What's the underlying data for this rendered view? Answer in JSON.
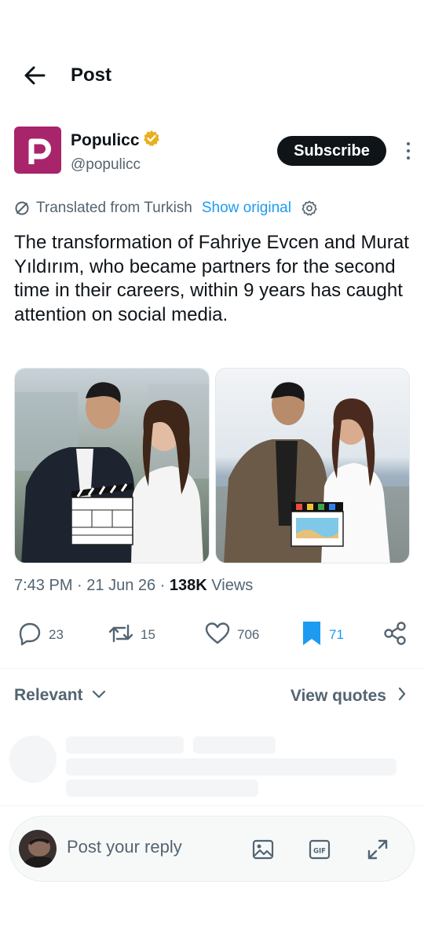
{
  "header": {
    "title": "Post"
  },
  "author": {
    "display_name": "Populicc",
    "handle": "@populicc",
    "subscribe_label": "Subscribe",
    "brand_color": "#a8246b",
    "verified_color": "#e8b020"
  },
  "translation": {
    "label": "Translated from Turkish",
    "show_original": "Show original"
  },
  "post": {
    "text": "The transformation of Fahriye Evcen and Murat Yıldırım, who became partners for the second time in their careers, within 9 years has caught attention on social media.",
    "images": [
      {
        "alt": "Couple in dark suit and white dress holding a black-and-white clapperboard"
      },
      {
        "alt": "Couple in brown jacket and white dress holding a colorful clapperboard by the sea"
      }
    ]
  },
  "meta": {
    "time": "7:43 PM",
    "date": "21 Jun 26",
    "views_count": "138K",
    "views_label": "Views"
  },
  "actions": {
    "replies": "23",
    "reposts": "15",
    "likes": "706",
    "bookmarks": "71",
    "bookmark_color": "#1d9bf0"
  },
  "replies_section": {
    "sort_label": "Relevant",
    "view_quotes": "View quotes"
  },
  "reply_bar": {
    "placeholder": "Post your reply"
  }
}
